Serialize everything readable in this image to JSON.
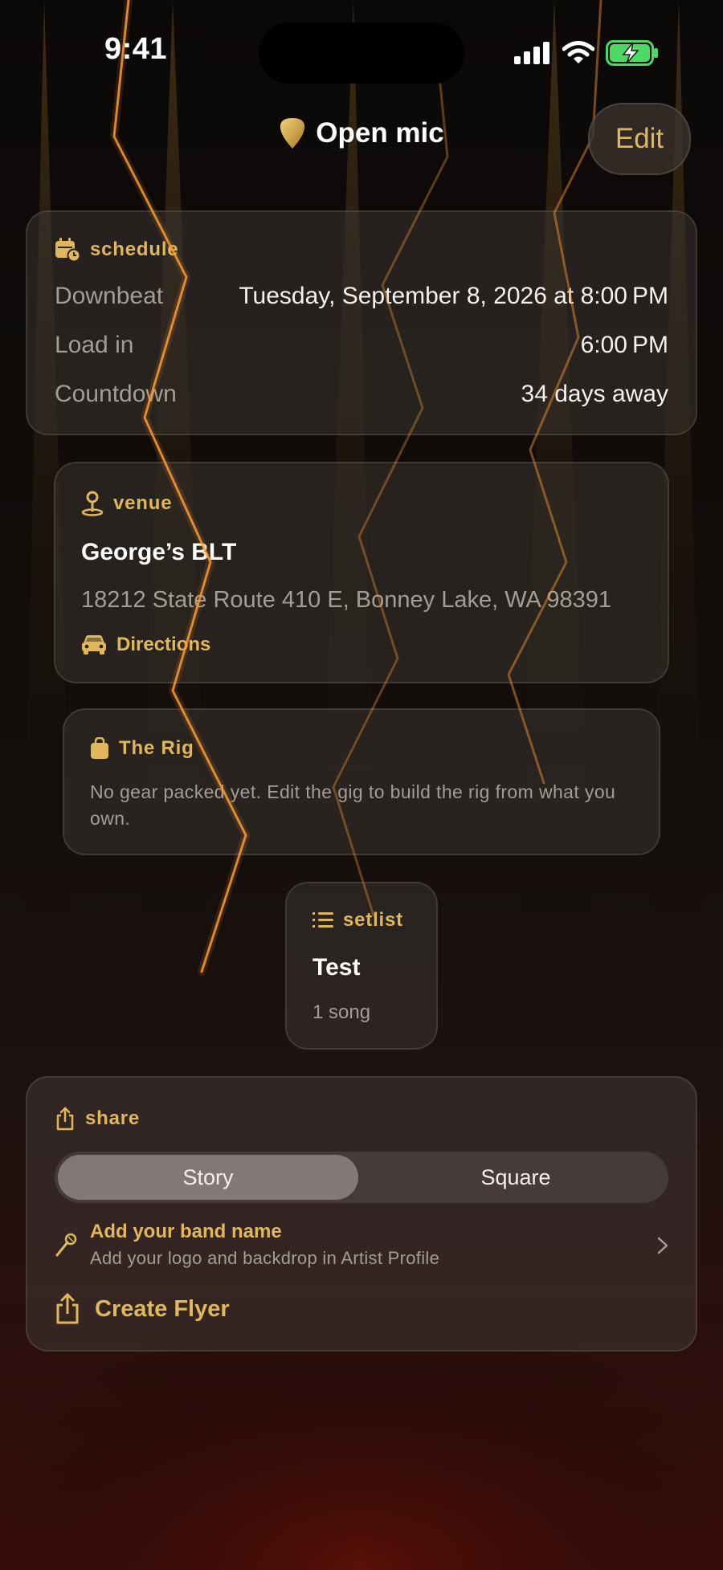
{
  "status_bar": {
    "time": "9:41"
  },
  "header": {
    "title": "Open mic",
    "edit_label": "Edit"
  },
  "schedule": {
    "heading": "schedule",
    "rows": [
      {
        "label": "Downbeat",
        "value": "Tuesday, September 8, 2026 at 8:00 PM"
      },
      {
        "label": "Load in",
        "value": "6:00 PM"
      },
      {
        "label": "Countdown",
        "value": "34 days away"
      }
    ]
  },
  "venue": {
    "heading": "venue",
    "name": "George’s BLT",
    "address": "18212 State Route 410 E, Bonney Lake, WA 98391",
    "directions_label": "Directions"
  },
  "rig": {
    "heading": "The Rig",
    "message": "No gear packed yet. Edit the gig to build the rig from what you own."
  },
  "setlist": {
    "heading": "setlist",
    "name": "Test",
    "count": "1 song"
  },
  "share": {
    "heading": "share",
    "options": [
      "Story",
      "Square"
    ],
    "selected": "Story",
    "band_title": "Add your band name",
    "band_subtitle": "Add your logo and backdrop in Artist Profile",
    "create_label": "Create Flyer"
  },
  "colors": {
    "accent": "#e0b75a",
    "bolt": "#ff9a2e",
    "background_top": "#0b0908",
    "background_bottom": "#3a0d0a"
  },
  "icons": [
    "guitar-pick-icon",
    "calendar-clock-icon",
    "map-pin-icon",
    "car-icon",
    "bag-icon",
    "list-icon",
    "share-icon",
    "microphone-icon",
    "chevron-right-icon"
  ]
}
